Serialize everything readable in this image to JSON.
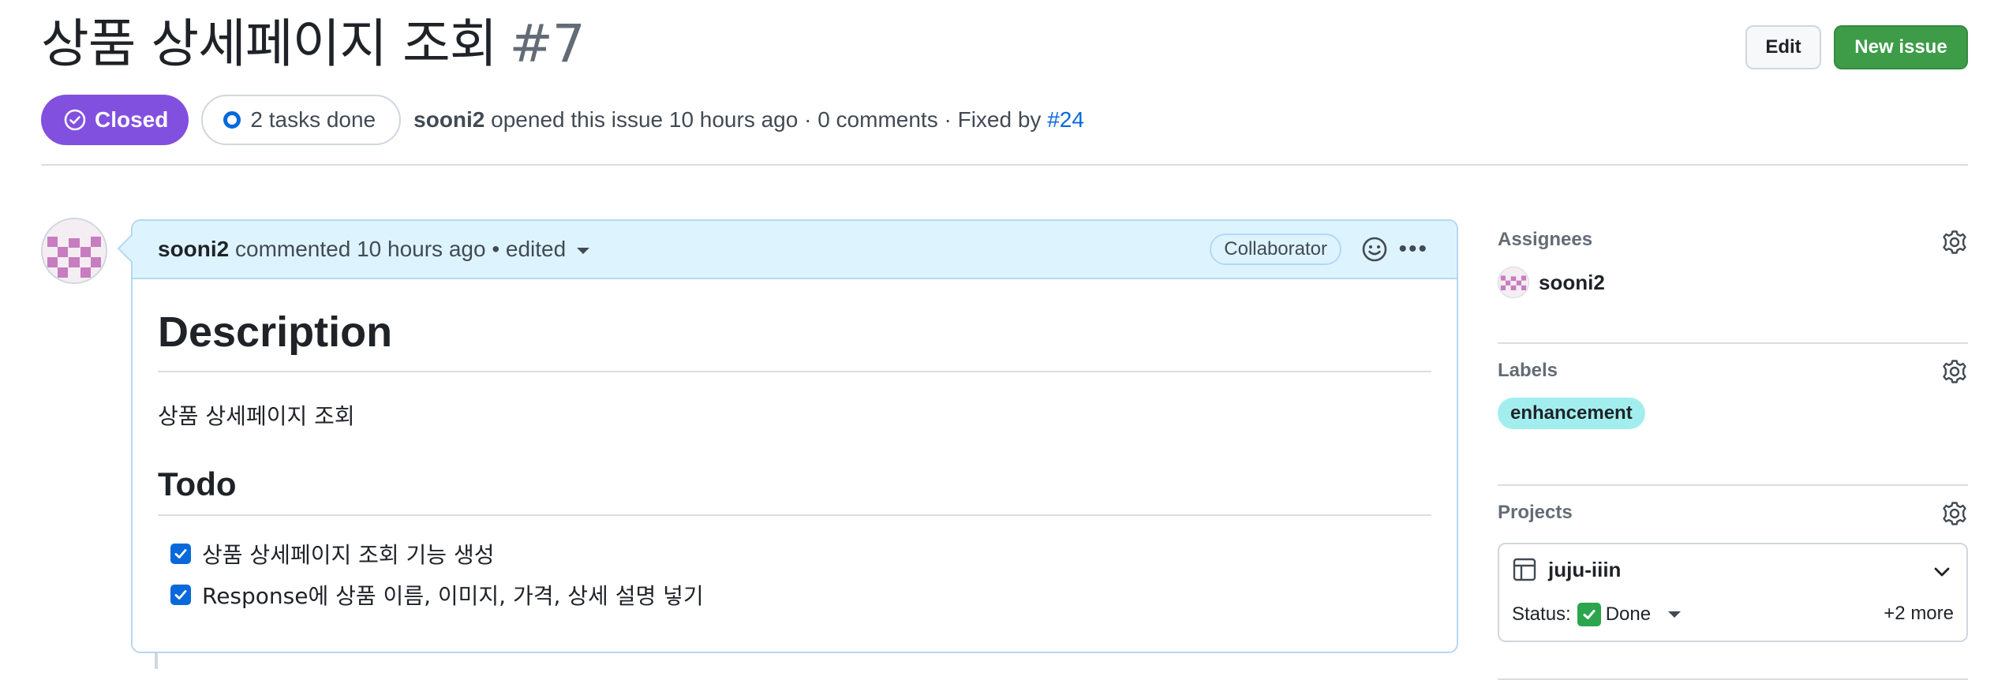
{
  "issue": {
    "title": "상품 상세페이지 조회",
    "number": "#7",
    "status": "Closed",
    "tasks": "2 tasks done",
    "author": "sooni2",
    "opened_text": "opened this issue 10 hours ago · 0 comments · Fixed by",
    "fixed_by": "#24"
  },
  "buttons": {
    "edit": "Edit",
    "new_issue": "New issue"
  },
  "comment": {
    "author": "sooni2",
    "meta": "commented 10 hours ago • edited",
    "role_badge": "Collaborator",
    "heading": "Description",
    "description": "상품 상세페이지 조회",
    "todo_heading": "Todo",
    "todos": [
      {
        "text": "상품 상세페이지 조회 기능 생성",
        "checked": true
      },
      {
        "text": "Response에 상품 이름, 이미지, 가격, 상세 설명 넣기",
        "checked": true
      }
    ]
  },
  "sidebar": {
    "assignees_title": "Assignees",
    "assignee": "sooni2",
    "labels_title": "Labels",
    "label": "enhancement",
    "projects_title": "Projects",
    "project_name": "juju-iiin",
    "status_label": "Status:",
    "status_value": "Done",
    "more": "+2 more"
  },
  "colors": {
    "closed": "#8250df",
    "new_issue": "#3e9c49",
    "link": "#0969da",
    "label_bg": "#a2eeef",
    "comment_header": "#ddf4ff"
  }
}
